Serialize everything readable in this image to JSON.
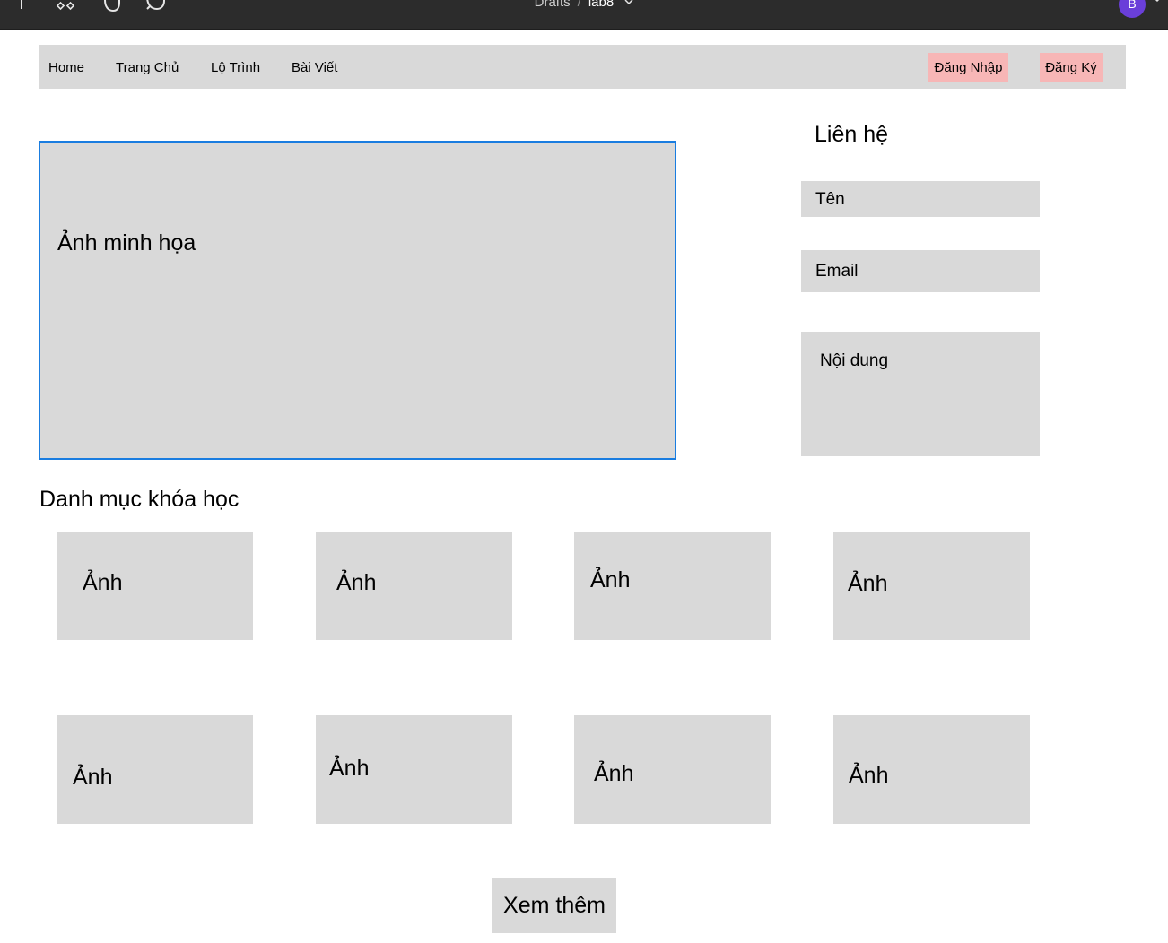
{
  "editor": {
    "breadcrumb_project": "Drafts",
    "breadcrumb_separator": "/",
    "file_name": "lab8",
    "avatar_initial": "B"
  },
  "nav": {
    "items": [
      {
        "label": "Home"
      },
      {
        "label": "Trang Chủ"
      },
      {
        "label": "Lộ Trình"
      },
      {
        "label": "Bài Viết"
      }
    ],
    "login": "Đăng Nhập",
    "register": "Đăng Ký"
  },
  "hero": {
    "label": "Ảnh minh họa"
  },
  "contact": {
    "title": "Liên hệ",
    "name": "Tên",
    "email": "Email",
    "message": "Nội dung"
  },
  "courses": {
    "title": "Danh mục khóa học",
    "cards": [
      {
        "label": "Ảnh"
      },
      {
        "label": "Ảnh"
      },
      {
        "label": "Ảnh"
      },
      {
        "label": "Ảnh"
      },
      {
        "label": "Ảnh"
      },
      {
        "label": "Ảnh"
      },
      {
        "label": "Ảnh"
      },
      {
        "label": "Ảnh"
      }
    ],
    "more_button": "Xem thêm"
  },
  "colors": {
    "toolbar_bg": "#2c2c2c",
    "placeholder_gray": "#d9d9d9",
    "auth_button_pink": "#f7b6b6",
    "selection_blue": "#1a7de0",
    "avatar_purple": "#6a3fd9"
  }
}
